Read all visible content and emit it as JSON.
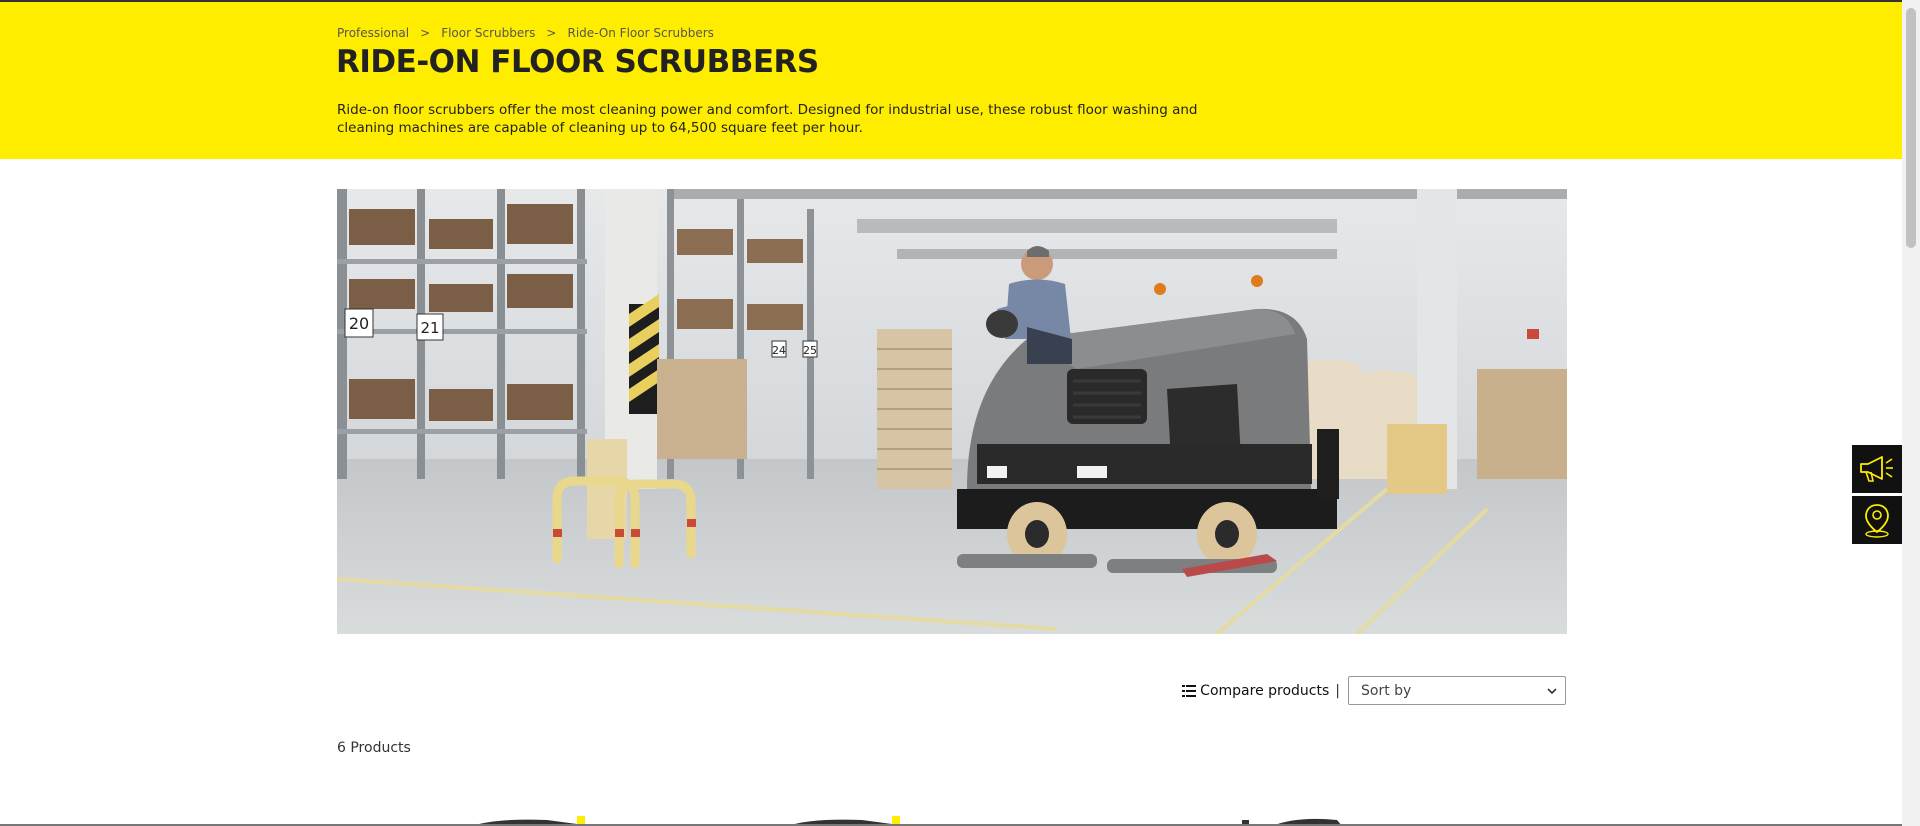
{
  "breadcrumb": {
    "items": [
      "Professional",
      "Floor Scrubbers",
      "Ride-On Floor Scrubbers"
    ],
    "separator": ">"
  },
  "page": {
    "title": "RIDE-ON FLOOR SCRUBBERS",
    "intro": "Ride-on floor scrubbers offer the most cleaning power and comfort. Designed for industrial use, these robust floor washing and cleaning machines are capable of cleaning up to 64,500 square feet per hour."
  },
  "hero": {
    "rack_numbers": [
      "20",
      "21",
      "24",
      "25"
    ]
  },
  "toolbar": {
    "compare_label": "Compare products",
    "divider": "|",
    "sort_placeholder": "Sort by"
  },
  "results": {
    "count_label": "6 Products"
  },
  "side_tools": {
    "icons": [
      "megaphone-icon",
      "location-pin-icon"
    ]
  },
  "colors": {
    "brand_yellow": "#ffed00",
    "side_button_bg": "#111111",
    "icon_yellow": "#ffed00"
  }
}
